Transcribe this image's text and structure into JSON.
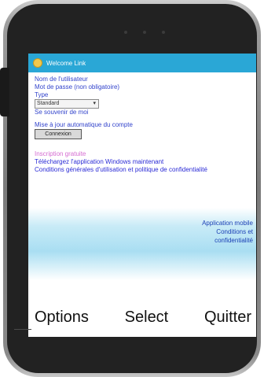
{
  "app": {
    "title": "Welcome Link"
  },
  "form": {
    "line1": "Nom de l'utilisateur",
    "line2": "Mot de passe (non obligatoire)",
    "line3": "Type",
    "select_value": "Standard",
    "line4": "Se souvenir de moi",
    "line5": "Mise à jour automatique du compte",
    "submit_label": "Connexion"
  },
  "links": {
    "pink": "Inscription gratuite",
    "line1": "Téléchargez l'application Windows maintenant",
    "line2": "Conditions générales d'utilisation et politique de confidentialité"
  },
  "banner": {
    "line1": "Application mobile",
    "line2": "Conditions et",
    "line3": "confidentialité"
  },
  "softkeys": {
    "left": "Options",
    "center": "Select",
    "right": "Quitter"
  },
  "colors": {
    "titlebar": "#2aa7d6",
    "link": "#3344cc",
    "accent_pink": "#d56bd1"
  }
}
